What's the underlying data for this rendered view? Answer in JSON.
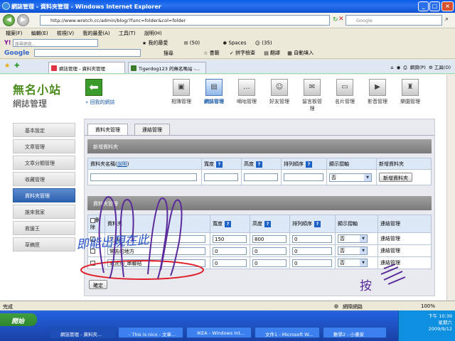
{
  "window": {
    "title": "網誌管理 - 資料夾管理 - Windows Internet Explorer"
  },
  "address": {
    "url": "http://www.wretch.cc/admin/blog/?func=folder&col=folder",
    "search_placeholder": "Google"
  },
  "menu": [
    "檔案(F)",
    "編輯(E)",
    "檢視(V)",
    "我的最愛(A)",
    "工具(T)",
    "說明(H)"
  ],
  "yahoo_toolbar": {
    "search_placeholder": "搜尋網頁...",
    "items": [
      "我的最愛",
      "(50)",
      "Spaces",
      "(35)"
    ]
  },
  "google_toolbar": {
    "logo": "Google",
    "items": [
      "搜尋",
      "書籤",
      "拼字檢查",
      "翻譯",
      "自動填入"
    ]
  },
  "browser_tabs": [
    {
      "label": "網誌管理 - 資料夾管理"
    },
    {
      "label": "Tigerdog123 的無名嗎站 -..."
    }
  ],
  "ie_commands": [
    "網頁(P)",
    "工具(O)"
  ],
  "site": {
    "logo": "無名小站",
    "subtitle": "網誌管理",
    "back_link": "» 回我的網誌"
  },
  "top_nav": [
    {
      "label": "相簿管理",
      "icon": "photo-icon"
    },
    {
      "label": "網誌管理",
      "icon": "blog-icon"
    },
    {
      "label": "嘀咕管理",
      "icon": "chat-icon"
    },
    {
      "label": "好友管理",
      "icon": "friends-icon"
    },
    {
      "label": "留言板管理",
      "icon": "guestbook-icon"
    },
    {
      "label": "名片管理",
      "icon": "card-icon"
    },
    {
      "label": "影音管理",
      "icon": "video-icon"
    },
    {
      "label": "樂園管理",
      "icon": "park-icon"
    }
  ],
  "side_nav": [
    "基本設定",
    "文章管理",
    "文章分類管理",
    "收藏管理",
    "資料夾管理",
    "誰來我家",
    "救援王",
    "草稿匣"
  ],
  "panel_tabs": [
    "資料夾管理",
    "連結管理"
  ],
  "new_folder": {
    "header": "新增資料夾",
    "col_name": "資料夾名稱(",
    "col_name_link": "說明",
    "col_name_end": ")",
    "col_width": "寬度",
    "col_height": "高度",
    "col_order": "排列順序",
    "col_show": "顯示摺軸",
    "col_new": "新增資料夾",
    "show_value": "否",
    "button": "新增資料夾"
  },
  "existing": {
    "header": "資料夾管理",
    "col_delete": "刪除",
    "col_folder": "資料夾",
    "col_width": "寬度",
    "col_height": "高度",
    "col_order": "排列順序",
    "col_show": "顯示摺軸",
    "col_link": "連結管理",
    "rows": [
      {
        "name": "生活",
        "width": "150",
        "height": "800",
        "order": "0",
        "show": "否",
        "link": "連結管理"
      },
      {
        "name": "常去的地方",
        "width": "0",
        "height": "0",
        "order": "0",
        "show": "否",
        "link": "連結管理"
      },
      {
        "name": "老虎狗_串聯貼",
        "width": "0",
        "height": "0",
        "order": "0",
        "show": "否",
        "link": "連結管理"
      }
    ],
    "confirm": "確定"
  },
  "annotation": {
    "text1": "即能出現在此",
    "text2": "按"
  },
  "status": {
    "left": "完成",
    "zone": "網際網路",
    "zoom": "100%"
  },
  "taskbar": {
    "start": "開始",
    "tasks": [
      "網誌管理 - 資料夾...",
      "- This is nico - 文章...",
      "IKEA - Windows Int...",
      "文件1 - Microsoft W...",
      "數學2 - 小畫家"
    ],
    "time": "下午 10:39",
    "weekday": "星期六",
    "date": "2009/9/12"
  },
  "colors": {
    "accent": "#2d62b0",
    "logo_green": "#4a8b1c",
    "annotation_red": "#e0202a",
    "annotation_purple": "#5a2a9a",
    "annotation_blue": "#2a55c8"
  }
}
